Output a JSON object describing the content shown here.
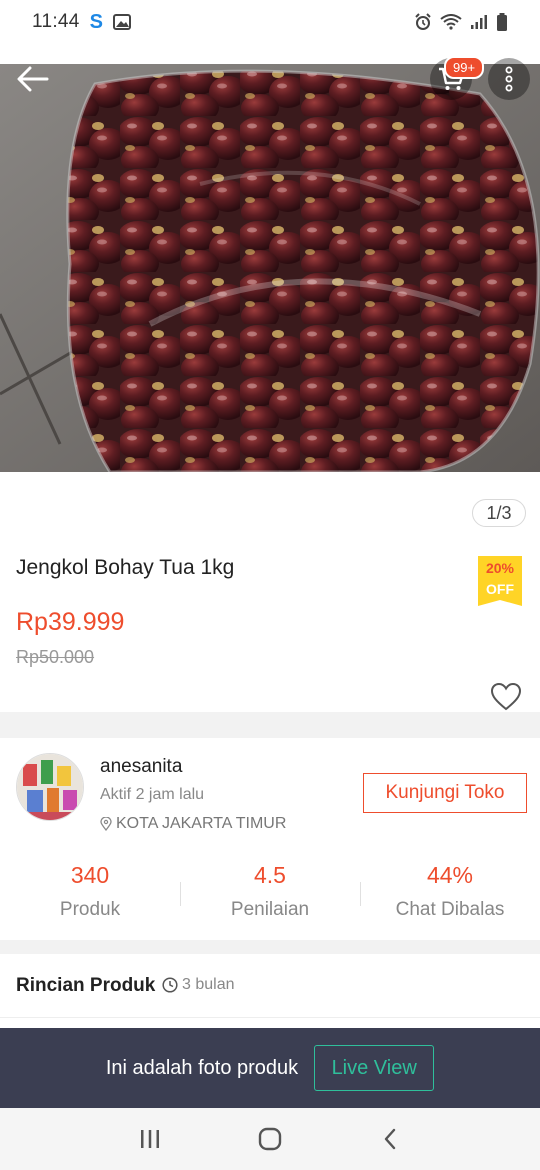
{
  "status_bar": {
    "time": "11:44"
  },
  "header": {
    "cart_badge": "99+"
  },
  "gallery": {
    "page_indicator": "1/3"
  },
  "product": {
    "title": "Jengkol Bohay Tua 1kg",
    "price": "Rp39.999",
    "original_price": "Rp50.000",
    "discount_percent": "20%",
    "discount_label": "OFF"
  },
  "shop": {
    "name": "anesanita",
    "active_status": "Aktif 2 jam lalu",
    "location": "KOTA JAKARTA TIMUR",
    "visit_label": "Kunjungi Toko",
    "stats": [
      {
        "value": "340",
        "label": "Produk"
      },
      {
        "value": "4.5",
        "label": "Penilaian"
      },
      {
        "value": "44%",
        "label": "Chat Dibalas"
      }
    ]
  },
  "details": {
    "title": "Rincian Produk",
    "time": "3 bulan"
  },
  "live_banner": {
    "text": "Ini adalah foto produk",
    "button_label": "Live View"
  },
  "colors": {
    "accent": "#ee4d2d",
    "live_green": "#2fbf9b",
    "banner_bg": "#3b3e52",
    "badge_yellow": "#ffd426"
  }
}
